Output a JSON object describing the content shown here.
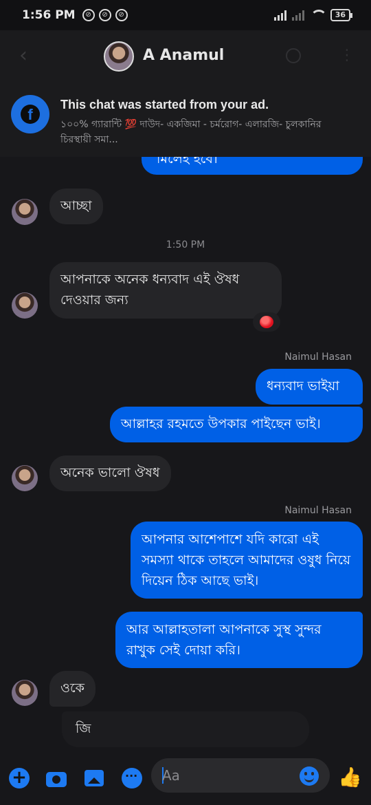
{
  "status_bar": {
    "time": "1:56 PM",
    "notifications": [
      "⊘",
      "⊘",
      "⊘"
    ],
    "battery": "36"
  },
  "header": {
    "contact_name": "A Anamul"
  },
  "ad_banner": {
    "title": "This chat was started from your ad.",
    "text": "১০০% গ্যারান্টি 💯 দাউদ- একজিমা - চর্মরোগ-  এলারজি- চুলকানির চিরস্থায়ী সমা..."
  },
  "messages": {
    "m0": "মিলেই হবে।",
    "m1": "আচ্ছা",
    "time_divider": "1:50 PM",
    "m2": "আপনাকে অনেক ধন্যবাদ এই ঔষধ দেওয়ার জন্য",
    "sender1": "Naimul Hasan",
    "m3": "ধন্যবাদ ভাইয়া",
    "m4": "আল্লাহর রহমতে উপকার পাইছেন ভাই।",
    "m5": "অনেক ভালো ঔষধ",
    "sender2": "Naimul Hasan",
    "m6": "আপনার আশেপাশে যদি কারো  এই সমস্যা থাকে তাহলে আমাদের ওষুধ নিয়ে দিয়েন ঠিক আছে ভাই।",
    "m7": "আর আল্লাহতালা আপনাকে সুস্থ সুন্দর রাখুক সেই দোয়া করি।",
    "m8": "ওকে",
    "m9": "জি"
  },
  "reaction": {
    "type": "heart",
    "color": "#e0111f"
  },
  "composer": {
    "placeholder": "Aa"
  },
  "colors": {
    "outgoing_bubble": "#0060e6",
    "incoming_bubble": "#252528",
    "accent": "#1d7af2",
    "background": "#17171a"
  }
}
